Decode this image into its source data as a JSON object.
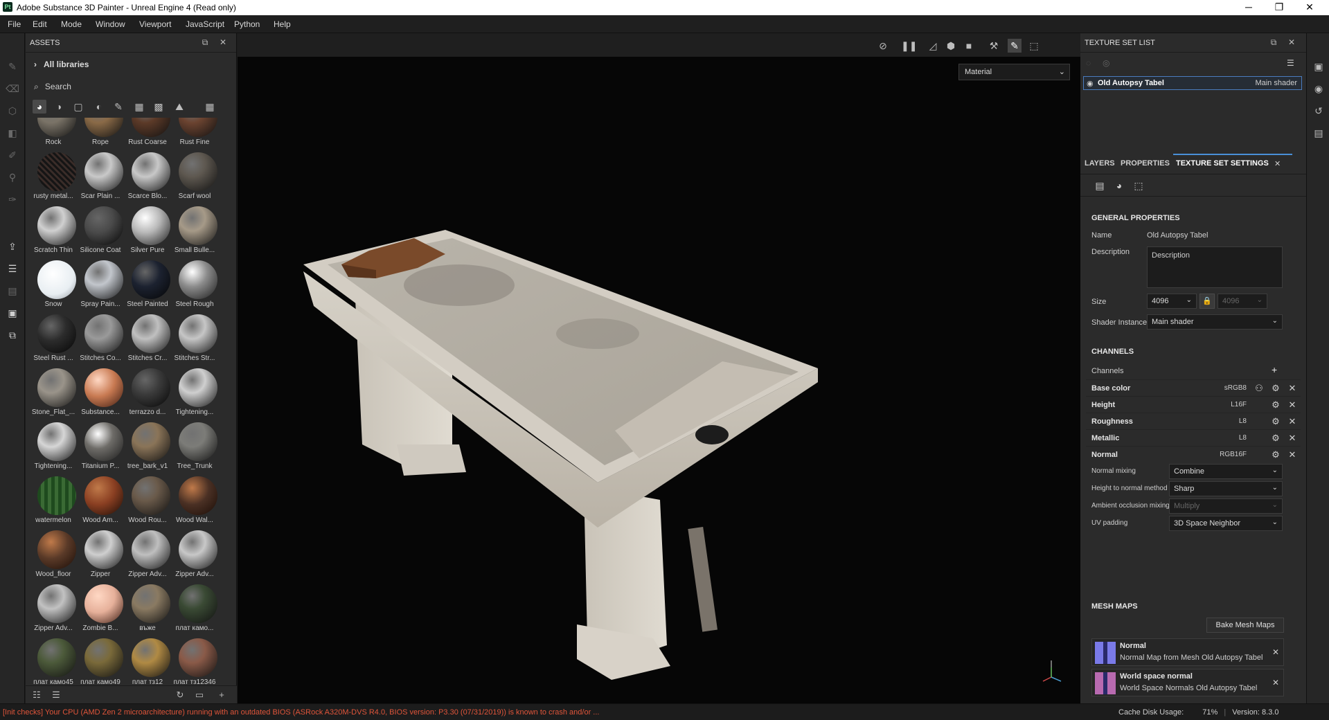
{
  "window": {
    "title": "Adobe Substance 3D Painter - Unreal Engine 4 (Read only)",
    "logo": "Pt",
    "controls": [
      "─",
      "❐",
      "✕"
    ]
  },
  "menu": [
    "File",
    "Edit",
    "Mode",
    "Window",
    "Viewport",
    "JavaScript",
    "Python",
    "Help"
  ],
  "assets": {
    "title": "ASSETS",
    "libraries": "All libraries",
    "search_placeholder": "Search",
    "items": [
      {
        "name": "Rock",
        "color": "#7a7367",
        "style": "rock"
      },
      {
        "name": "Rope",
        "color": "#8a6a47",
        "style": "rope"
      },
      {
        "name": "Rust Coarse",
        "color": "#5c3a28",
        "style": "rust"
      },
      {
        "name": "Rust Fine",
        "color": "#6b4330",
        "style": "rust"
      },
      {
        "name": "rusty metal...",
        "color": "#3a2c28",
        "style": "mesh"
      },
      {
        "name": "Scar Plain ...",
        "color": "#c9c9c9",
        "style": "scar"
      },
      {
        "name": "Scarce Blo...",
        "color": "#c8c8c8",
        "style": "blood"
      },
      {
        "name": "Scarf wool",
        "color": "#5e5850",
        "style": "matte"
      },
      {
        "name": "Scratch Thin",
        "color": "#d0d0d0",
        "style": "plain"
      },
      {
        "name": "Silicone Coat",
        "color": "#4a4a4a",
        "style": "dark"
      },
      {
        "name": "Silver Pure",
        "color": "#b8b8b8",
        "style": "metal"
      },
      {
        "name": "Small Bulle...",
        "color": "#a69a88",
        "style": "rock"
      },
      {
        "name": "Snow",
        "color": "#e8eef2",
        "style": "snow"
      },
      {
        "name": "Spray Pain...",
        "color": "#c2c6cc",
        "style": "plain"
      },
      {
        "name": "Steel Painted",
        "color": "#1c2230",
        "style": "dark"
      },
      {
        "name": "Steel Rough",
        "color": "#8c8c8c",
        "style": "metal"
      },
      {
        "name": "Steel Rust ...",
        "color": "#2c2c2c",
        "style": "dark"
      },
      {
        "name": "Stitches Co...",
        "color": "#9a9a9a",
        "style": "stitch"
      },
      {
        "name": "Stitches Cr...",
        "color": "#c0c0c0",
        "style": "stitch"
      },
      {
        "name": "Stitches Str...",
        "color": "#c6c6c6",
        "style": "stitch"
      },
      {
        "name": "Stone_Flat_...",
        "color": "#9a948a",
        "style": "rock"
      },
      {
        "name": "Substance...",
        "color": "#c87a52",
        "style": "skin"
      },
      {
        "name": "terrazzo d...",
        "color": "#3a3a3a",
        "style": "dark"
      },
      {
        "name": "Tightening...",
        "color": "#cfcfcf",
        "style": "plain"
      },
      {
        "name": "Tightening...",
        "color": "#d6d6d6",
        "style": "plain"
      },
      {
        "name": "Titanium P...",
        "color": "#6e6c68",
        "style": "metal"
      },
      {
        "name": "tree_bark_v1",
        "color": "#8a7458",
        "style": "bark"
      },
      {
        "name": "Tree_Trunk",
        "color": "#7c7c78",
        "style": "rock"
      },
      {
        "name": "watermelon",
        "color": "#3a6a34",
        "style": "melon"
      },
      {
        "name": "Wood Am...",
        "color": "#8a3f22",
        "style": "wood"
      },
      {
        "name": "Wood Rou...",
        "color": "#6a5a4a",
        "style": "matte"
      },
      {
        "name": "Wood Wal...",
        "color": "#4a3024",
        "style": "wood"
      },
      {
        "name": "Wood_floor",
        "color": "#5a3a28",
        "style": "wood"
      },
      {
        "name": "Zipper",
        "color": "#cfcfcf",
        "style": "plain"
      },
      {
        "name": "Zipper Adv...",
        "color": "#bfbfbf",
        "style": "zipper"
      },
      {
        "name": "Zipper Adv...",
        "color": "#c8c8c8",
        "style": "zipper"
      },
      {
        "name": "Zipper Adv...",
        "color": "#c2c2c2",
        "style": "plain"
      },
      {
        "name": "Zombie B...",
        "color": "#e6b09a",
        "style": "skin"
      },
      {
        "name": "въже",
        "color": "#8a7a62",
        "style": "rope"
      },
      {
        "name": "плат камо...",
        "color": "#3a4a34",
        "style": "camo"
      },
      {
        "name": "плат камо45",
        "color": "#4c5a3a",
        "style": "camo"
      },
      {
        "name": "плат камо49",
        "color": "#7a6a3a",
        "style": "camo"
      },
      {
        "name": "плат тз12",
        "color": "#b08a44",
        "style": "fabric"
      },
      {
        "name": "плат тз12346",
        "color": "#8a5a48",
        "style": "fabric"
      }
    ]
  },
  "viewport": {
    "mode": "Material"
  },
  "texture_set_list": {
    "title": "TEXTURE SET LIST",
    "set_name": "Old Autopsy Tabel",
    "shader": "Main shader"
  },
  "tabs": [
    "LAYERS",
    "PROPERTIES",
    "TEXTURE SET SETTINGS"
  ],
  "general": {
    "heading": "GENERAL PROPERTIES",
    "name_label": "Name",
    "name_value": "Old Autopsy Tabel",
    "desc_label": "Description",
    "desc_value": "Description",
    "size_label": "Size",
    "size_value": "4096",
    "size_value2": "4096",
    "shader_label": "Shader Instance",
    "shader_value": "Main shader"
  },
  "channels": {
    "heading": "CHANNELS",
    "label": "Channels",
    "items": [
      {
        "name": "Base color",
        "format": "sRGB8"
      },
      {
        "name": "Height",
        "format": "L16F"
      },
      {
        "name": "Roughness",
        "format": "L8"
      },
      {
        "name": "Metallic",
        "format": "L8"
      },
      {
        "name": "Normal",
        "format": "RGB16F"
      }
    ]
  },
  "mixing": [
    {
      "label": "Normal mixing",
      "value": "Combine",
      "disabled": false
    },
    {
      "label": "Height to normal method",
      "value": "Sharp",
      "disabled": false
    },
    {
      "label": "Ambient occlusion mixing",
      "value": "Multiply",
      "disabled": true
    },
    {
      "label": "UV padding",
      "value": "3D Space Neighbor",
      "disabled": false
    }
  ],
  "mesh_maps": {
    "heading": "MESH MAPS",
    "bake_button": "Bake Mesh Maps",
    "items": [
      {
        "name": "Normal",
        "desc": "Normal Map from Mesh Old Autopsy Tabel",
        "color": "#7a7ae8"
      },
      {
        "name": "World space normal",
        "desc": "World Space Normals Old Autopsy Tabel",
        "color": "#b86ab0"
      }
    ]
  },
  "status": {
    "message": "[Init checks] Your CPU (AMD Zen 2 microarchitecture) running with an outdated BIOS (ASRock A320M-DVS R4.0, BIOS version: P3.30 (07/31/2019)) is known to crash and/or ...",
    "cache_label": "Cache Disk Usage:",
    "cache_value": "71%",
    "version": "Version: 8.3.0"
  }
}
